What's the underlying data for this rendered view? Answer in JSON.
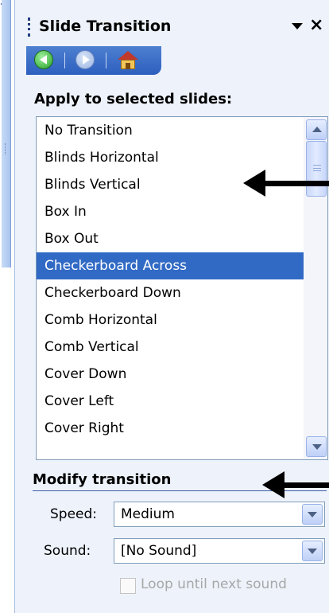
{
  "pane": {
    "title": "Slide Transition",
    "close_glyph": "×"
  },
  "nav": {
    "back_icon": "back-arrow-icon",
    "forward_icon": "forward-arrow-icon",
    "home_icon": "home-icon"
  },
  "apply": {
    "label": "Apply to selected slides:",
    "items": [
      "No Transition",
      "Blinds Horizontal",
      "Blinds Vertical",
      "Box In",
      "Box Out",
      "Checkerboard Across",
      "Checkerboard Down",
      "Comb Horizontal",
      "Comb Vertical",
      "Cover Down",
      "Cover Left",
      "Cover Right"
    ],
    "selected_index": 5
  },
  "modify": {
    "label": "Modify transition",
    "speed_label": "Speed:",
    "speed_value": "Medium",
    "sound_label": "Sound:",
    "sound_value": "[No Sound]",
    "loop_label": "Loop until next sound",
    "loop_checked": false
  },
  "colors": {
    "selection": "#316ac5",
    "pane_bg": "#eef3fb",
    "nav_bar": "#2d5fbf"
  }
}
